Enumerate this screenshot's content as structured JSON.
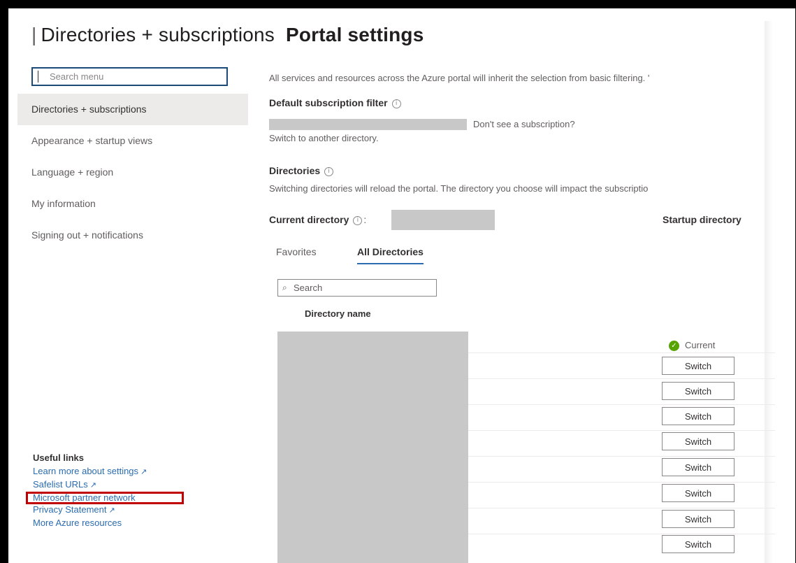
{
  "header": {
    "title_main": "Portal settings",
    "separator": "|",
    "title_sub": "Directories + subscriptions"
  },
  "sidebar": {
    "search_placeholder": "Search menu",
    "items": [
      {
        "label": "Directories + subscriptions",
        "active": true
      },
      {
        "label": "Appearance + startup views"
      },
      {
        "label": "Language + region"
      },
      {
        "label": "My information"
      },
      {
        "label": "Signing out + notifications"
      }
    ],
    "useful_links": {
      "title": "Useful links",
      "links": [
        {
          "label": "Learn more about settings",
          "external": true
        },
        {
          "label": "Safelist URLs",
          "external": true
        },
        {
          "label": "Microsoft partner network",
          "highlighted": true
        },
        {
          "label": "Privacy Statement",
          "external": true
        },
        {
          "label": "More Azure resources"
        }
      ]
    }
  },
  "main": {
    "intro": "All services and resources across the Azure portal will inherit the selection from basic filtering. '",
    "default_filter": {
      "title": "Default subscription filter",
      "dont_see": "Don't see a subscription?",
      "switch_text": "Switch to another directory."
    },
    "directories": {
      "title": "Directories",
      "description": "Switching directories will reload the portal. The directory you choose will impact the subscriptio"
    },
    "current_directory_label": "Current directory",
    "current_directory_colon": ":",
    "startup_directory_label": "Startup directory",
    "tabs": [
      {
        "label": "Favorites"
      },
      {
        "label": "All Directories",
        "active": true
      }
    ],
    "search_placeholder": "Search",
    "column_header": "Directory name",
    "current_status": "Current",
    "switch_label": "Switch"
  },
  "colors": {
    "accent": "#2b6cb0",
    "highlight": "#c00000",
    "success": "#57a300",
    "redacted": "#c8c8c8"
  },
  "icons": {
    "info": "info-icon",
    "external": "external-link-icon",
    "search": "search-icon",
    "check": "checkmark-icon"
  }
}
